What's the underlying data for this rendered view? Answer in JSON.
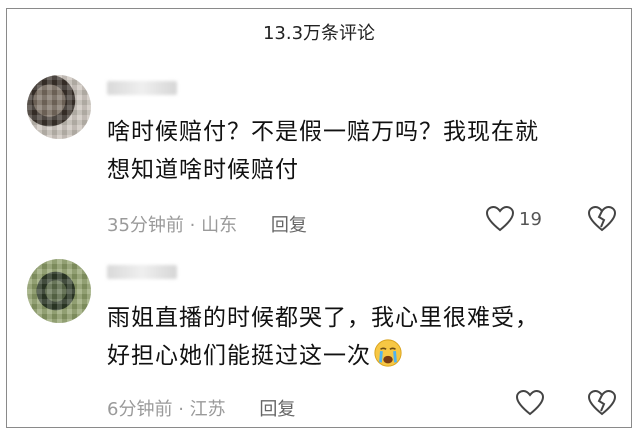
{
  "header": {
    "title": "13.3万条评论"
  },
  "comments": [
    {
      "text_line1": "啥时候赔付？不是假一赔万吗？我现在就",
      "text_line2": "想知道啥时候赔付",
      "time": "35分钟前",
      "dot": "·",
      "location": "山东",
      "reply_label": "回复",
      "likes": "19"
    },
    {
      "text_line1": "雨姐直播的时候都哭了，我心里很难受，",
      "text_line2": "好担心她们能挺过这一次",
      "emoji": "crying-face-emoji",
      "time": "6分钟前",
      "dot": "·",
      "location": "江苏",
      "reply_label": "回复",
      "likes": ""
    }
  ]
}
